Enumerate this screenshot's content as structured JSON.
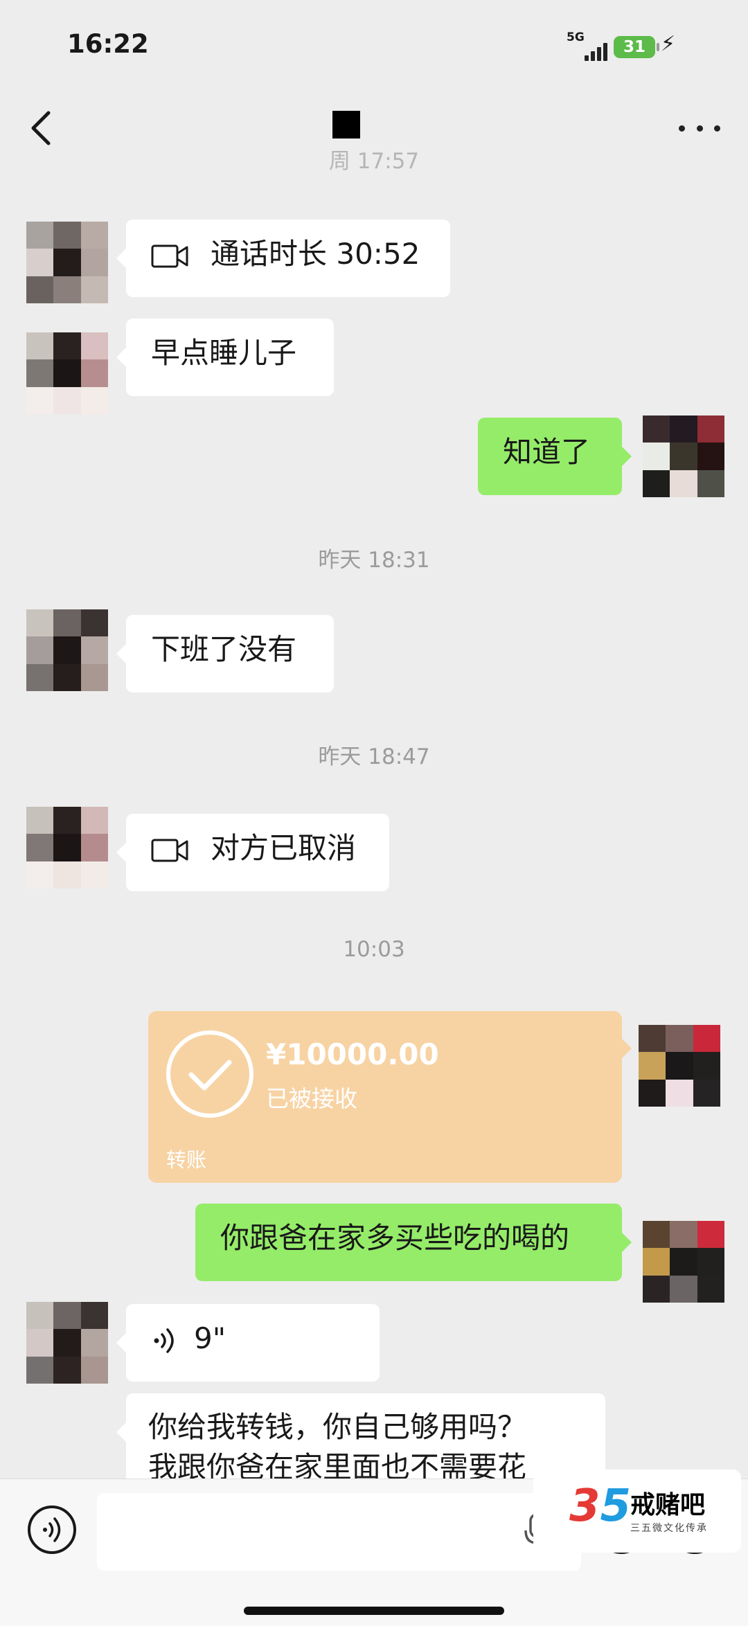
{
  "status_bar": {
    "time": "16:22",
    "network": "5G",
    "battery": "31"
  },
  "nav": {
    "title": ""
  },
  "messages": {
    "partial_ts": "周 17:57",
    "call_duration": "通话时长 30:52",
    "msg_sleep": "早点睡儿子",
    "msg_know": "知道了",
    "ts_1831": "昨天 18:31",
    "msg_offwork": "下班了没有",
    "ts_1847": "昨天 18:47",
    "call_cancel": "对方已取消",
    "ts_1003": "10:03",
    "transfer": {
      "amount": "¥10000.00",
      "status": "已被接收",
      "label": "转账"
    },
    "msg_buy": "你跟爸在家多买些吃的喝的",
    "voice_duration": "9\"",
    "msg_long_1": "你给我转钱，你自己够用吗？",
    "msg_long_2": "我跟你爸在家里面也不需要花"
  },
  "watermark": {
    "number_a": "3",
    "number_b": "5",
    "name": "戒赌吧",
    "tagline": "三五微文化传承"
  },
  "colors": {
    "background": "#ededed",
    "outgoing": "#95ec69",
    "incoming": "#ffffff",
    "transfer": "#f7d3a4"
  }
}
